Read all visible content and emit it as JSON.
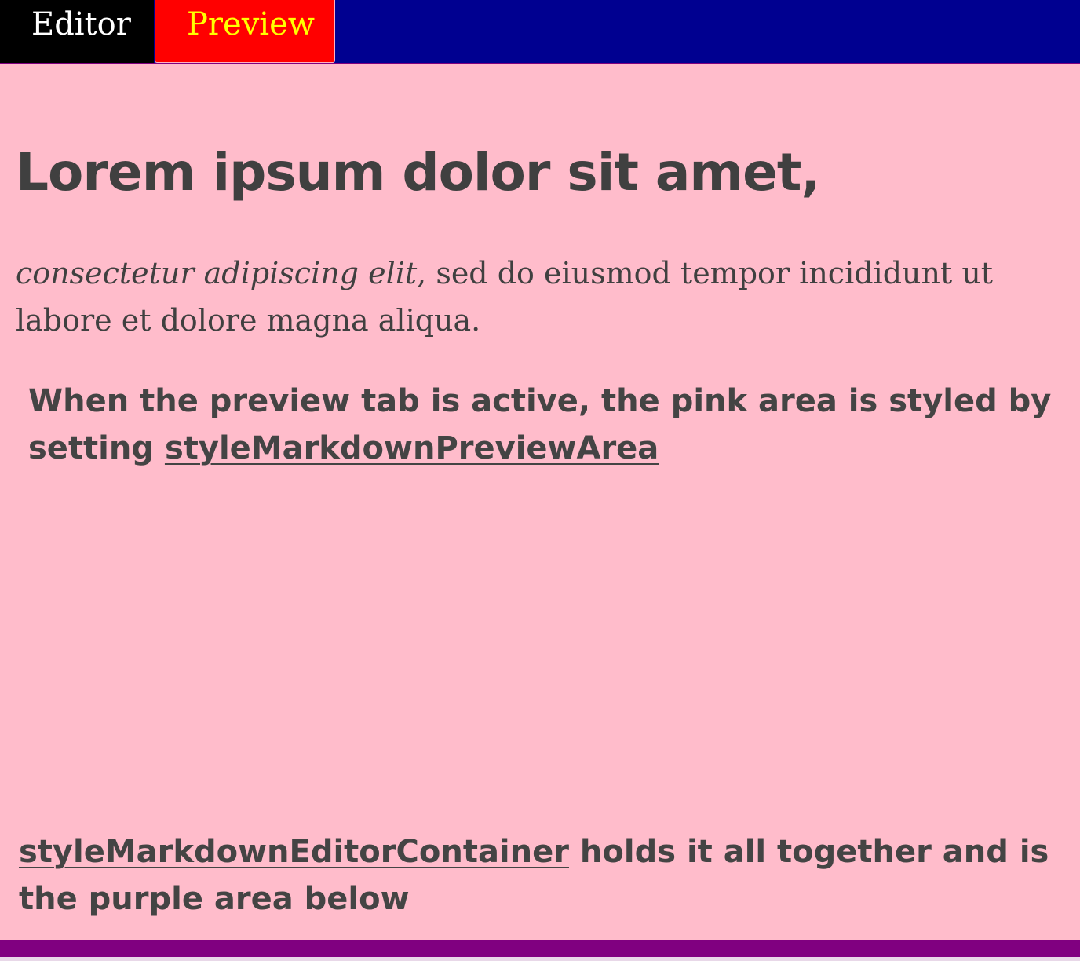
{
  "tabs": {
    "editor_label": "Editor",
    "preview_label": "Preview"
  },
  "preview": {
    "heading": "Lorem ipsum dolor sit amet,",
    "paragraph_italic": "consectetur adipiscing elit",
    "paragraph_rest": ", sed do eiusmod tempor incididunt ut labore et dolore magna aliqua.",
    "note_preview_text": "When the preview tab is active, the pink area is styled by setting ",
    "note_preview_link": "styleMarkdownPreviewArea",
    "note_container_link": "styleMarkdownEditorContainer",
    "note_container_text": " holds it all together and is the purple area below"
  },
  "colors": {
    "tabbar_bg": "#000090",
    "editor_tab_bg": "#000000",
    "editor_tab_text": "#ffffff",
    "preview_tab_bg": "#ff0000",
    "preview_tab_text": "#ffff00",
    "preview_area_bg": "#ffbccb",
    "container_bg": "#800080",
    "text": "#444444"
  }
}
